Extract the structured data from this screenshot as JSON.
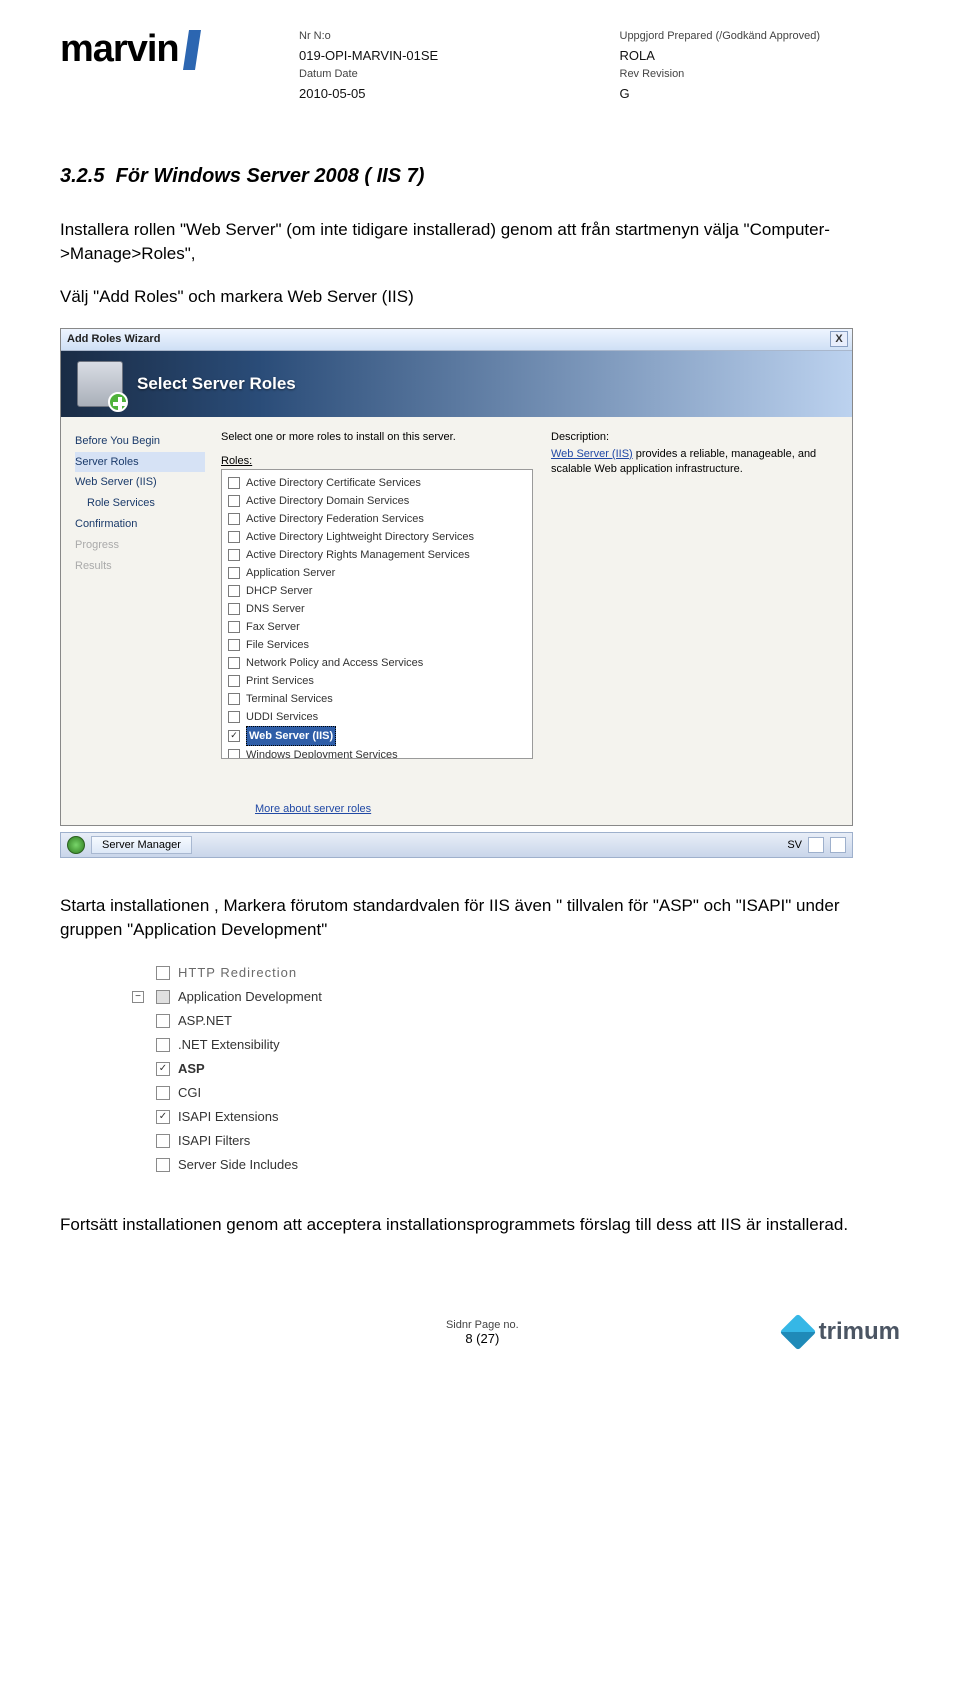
{
  "header": {
    "logo_text": "marvin",
    "left": {
      "nr_label": "Nr N:o",
      "nr_value": "019-OPI-MARVIN-01SE",
      "date_label": "Datum  Date",
      "date_value": "2010-05-05"
    },
    "right": {
      "prep_label": "Uppgjord  Prepared (/Godkänd Approved)",
      "prep_value": "ROLA",
      "rev_label": "Rev Revision",
      "rev_value": "G"
    }
  },
  "section": {
    "number": "3.2.5",
    "title": "För Windows Server 2008 ( IIS 7)"
  },
  "para1": "Installera rollen \"Web Server\" (om inte tidigare installerad) genom att från startmenyn välja \"Computer->Manage>Roles\",",
  "para2": "Välj \"Add Roles\" och markera Web Server (IIS)",
  "wizard": {
    "title": "Add Roles Wizard",
    "close": "X",
    "head": "Select Server Roles",
    "nav": [
      {
        "t": "Before You Begin",
        "c": ""
      },
      {
        "t": "Server Roles",
        "c": "sel"
      },
      {
        "t": "Web Server (IIS)",
        "c": ""
      },
      {
        "t": "Role Services",
        "c": "sub"
      },
      {
        "t": "Confirmation",
        "c": ""
      },
      {
        "t": "Progress",
        "c": "dim"
      },
      {
        "t": "Results",
        "c": "dim"
      }
    ],
    "intro": "Select one or more roles to install on this server.",
    "roles_label": "Roles:",
    "roles": [
      {
        "n": "Active Directory Certificate Services",
        "chk": false,
        "sel": false
      },
      {
        "n": "Active Directory Domain Services",
        "chk": false,
        "sel": false
      },
      {
        "n": "Active Directory Federation Services",
        "chk": false,
        "sel": false
      },
      {
        "n": "Active Directory Lightweight Directory Services",
        "chk": false,
        "sel": false
      },
      {
        "n": "Active Directory Rights Management Services",
        "chk": false,
        "sel": false
      },
      {
        "n": "Application Server",
        "chk": false,
        "sel": false
      },
      {
        "n": "DHCP Server",
        "chk": false,
        "sel": false
      },
      {
        "n": "DNS Server",
        "chk": false,
        "sel": false
      },
      {
        "n": "Fax Server",
        "chk": false,
        "sel": false
      },
      {
        "n": "File Services",
        "chk": false,
        "sel": false
      },
      {
        "n": "Network Policy and Access Services",
        "chk": false,
        "sel": false
      },
      {
        "n": "Print Services",
        "chk": false,
        "sel": false
      },
      {
        "n": "Terminal Services",
        "chk": false,
        "sel": false
      },
      {
        "n": "UDDI Services",
        "chk": false,
        "sel": false
      },
      {
        "n": "Web Server (IIS)",
        "chk": true,
        "sel": true
      },
      {
        "n": "Windows Deployment Services",
        "chk": false,
        "sel": false
      }
    ],
    "desc_label": "Description:",
    "desc_link": "Web Server (IIS)",
    "desc_text": " provides a reliable, manageable, and scalable Web application infrastructure.",
    "footer_link": "More about server roles"
  },
  "taskbar": {
    "btn": "Server Manager",
    "lang": "SV"
  },
  "para3": "Starta installationen , Markera förutom standardvalen för IIS även  \" tillvalen för \"ASP\" och \"ISAPI\" under gruppen \"Application Development\"",
  "appdev": {
    "cutoff": "HTTP Redirection",
    "group": "Application Development",
    "items": [
      {
        "n": "ASP.NET",
        "chk": false,
        "sel": false
      },
      {
        "n": ".NET Extensibility",
        "chk": false,
        "sel": false
      },
      {
        "n": "ASP",
        "chk": true,
        "sel": true
      },
      {
        "n": "CGI",
        "chk": false,
        "sel": false
      },
      {
        "n": "ISAPI Extensions",
        "chk": true,
        "sel": false
      },
      {
        "n": "ISAPI Filters",
        "chk": false,
        "sel": false
      },
      {
        "n": "Server Side Includes",
        "chk": false,
        "sel": false
      }
    ]
  },
  "para4": "Fortsätt installationen genom att acceptera installationsprogrammets förslag till dess att IIS är installerad.",
  "footer": {
    "page_label": "Sidnr  Page no.",
    "page_value": "8 (27)",
    "brand": "trimum"
  }
}
